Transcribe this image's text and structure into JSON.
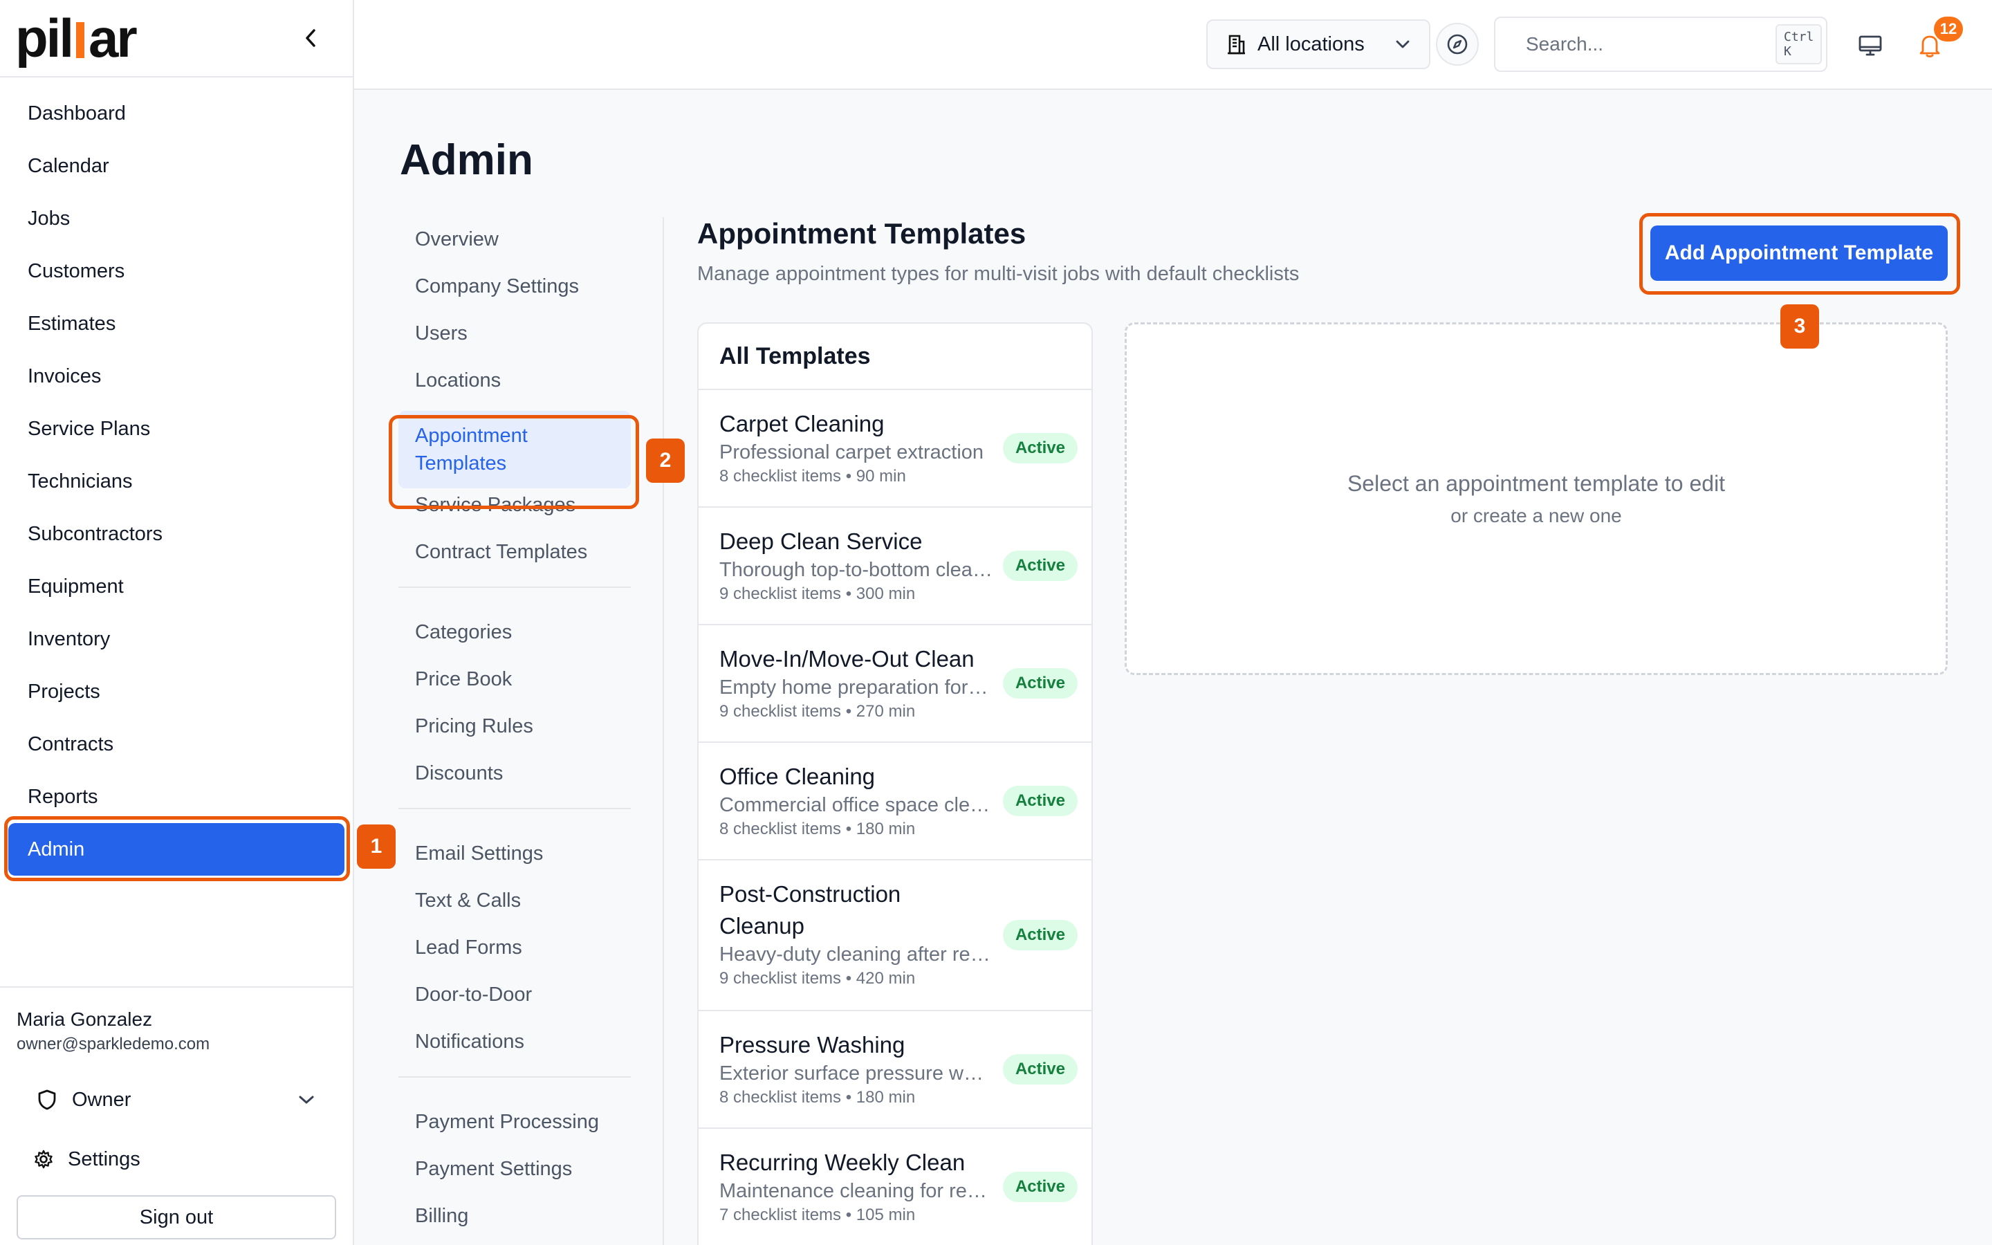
{
  "brand": {
    "logo_text": "pillar"
  },
  "sidebar": {
    "items": [
      {
        "label": "Dashboard"
      },
      {
        "label": "Calendar"
      },
      {
        "label": "Jobs"
      },
      {
        "label": "Customers"
      },
      {
        "label": "Estimates"
      },
      {
        "label": "Invoices"
      },
      {
        "label": "Service Plans"
      },
      {
        "label": "Technicians"
      },
      {
        "label": "Subcontractors"
      },
      {
        "label": "Equipment"
      },
      {
        "label": "Inventory"
      },
      {
        "label": "Projects"
      },
      {
        "label": "Contracts"
      },
      {
        "label": "Reports"
      },
      {
        "label": "Admin",
        "active": true
      }
    ],
    "user": {
      "name": "Maria Gonzalez",
      "email": "owner@sparkledemo.com",
      "role": "Owner"
    },
    "settings_label": "Settings",
    "signout_label": "Sign out"
  },
  "topbar": {
    "location_select": "All locations",
    "search_placeholder": "Search...",
    "search_shortcut": "Ctrl K",
    "notifications_count": "12"
  },
  "page": {
    "title": "Admin"
  },
  "admin_nav": {
    "groups": [
      [
        "Overview",
        "Company Settings",
        "Users",
        "Locations",
        "Appointment Templates",
        "Service Packages",
        "Contract Templates"
      ],
      [
        "Categories",
        "Price Book",
        "Pricing Rules",
        "Discounts"
      ],
      [
        "Email Settings",
        "Text & Calls",
        "Lead Forms",
        "Door-to-Door",
        "Notifications"
      ],
      [
        "Payment Processing",
        "Payment Settings",
        "Billing"
      ]
    ],
    "active": "Appointment Templates"
  },
  "content": {
    "title": "Appointment Templates",
    "subtitle": "Manage appointment types for multi-visit jobs with default checklists",
    "add_button": "Add Appointment Template",
    "list_header": "All Templates",
    "templates": [
      {
        "name": "Carpet Cleaning",
        "desc": "Professional carpet extraction",
        "meta": "8 checklist items • 90 min",
        "status": "Active"
      },
      {
        "name": "Deep Clean Service",
        "desc": "Thorough top-to-bottom cleaning",
        "meta": "9 checklist items • 300 min",
        "status": "Active"
      },
      {
        "name": "Move-In/Move-Out Clean",
        "desc": "Empty home preparation for new occupants",
        "meta": "9 checklist items • 270 min",
        "status": "Active"
      },
      {
        "name": "Office Cleaning",
        "desc": "Commercial office space cleaning",
        "meta": "8 checklist items • 180 min",
        "status": "Active"
      },
      {
        "name": "Post-Construction Cleanup",
        "desc": "Heavy-duty cleaning after renovation",
        "meta": "9 checklist items • 420 min",
        "status": "Active"
      },
      {
        "name": "Pressure Washing",
        "desc": "Exterior surface pressure washing",
        "meta": "8 checklist items • 180 min",
        "status": "Active"
      },
      {
        "name": "Recurring Weekly Clean",
        "desc": "Maintenance cleaning for regular clients",
        "meta": "7 checklist items • 105 min",
        "status": "Active"
      }
    ],
    "empty_main": "Select an appointment template to edit",
    "empty_sub": "or create a new one"
  },
  "steps": [
    "1",
    "2",
    "3"
  ],
  "colors": {
    "accent": "#2563eb",
    "highlight": "#ea580c",
    "brand_orange": "#f97316",
    "active_badge_bg": "#dcfce7",
    "active_badge_text": "#15803d"
  }
}
